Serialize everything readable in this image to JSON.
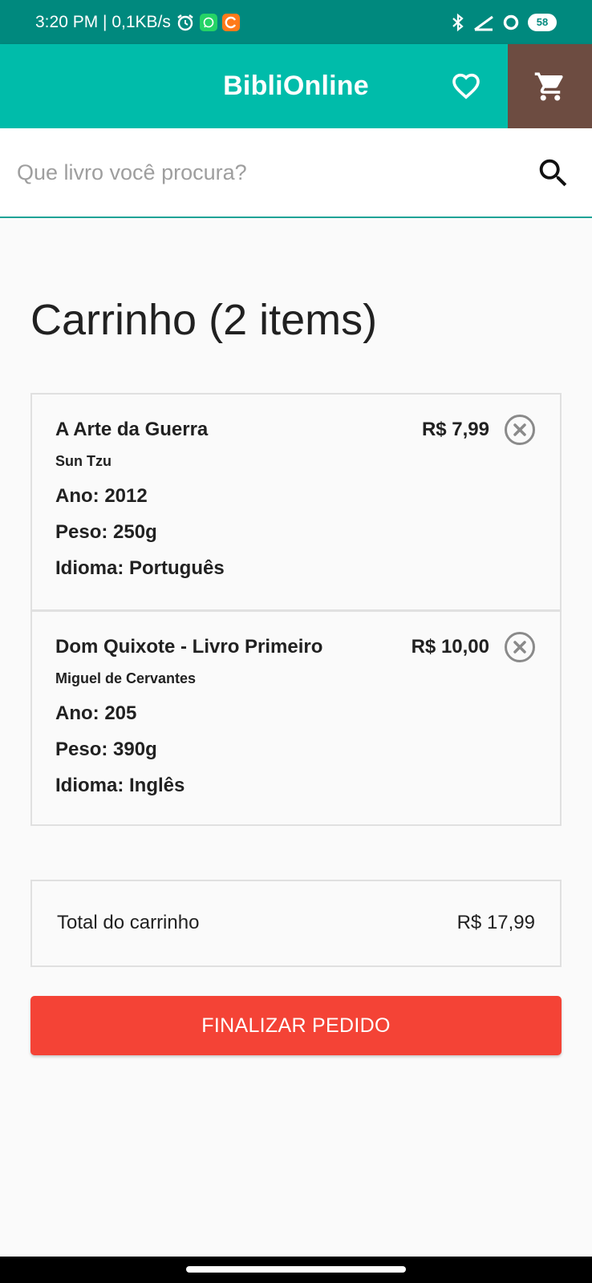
{
  "status_bar": {
    "time_speed": "3:20 PM | 0,1KB/s",
    "battery": "58",
    "icons": [
      "alarm-icon",
      "whatsapp-icon",
      "app-icon",
      "bluetooth-icon",
      "signal-icon",
      "circle-icon",
      "battery-icon"
    ],
    "colors": {
      "background": "#00897e"
    }
  },
  "app_bar": {
    "title": "BibliOnline",
    "favorites_icon": "heart-icon",
    "cart_icon": "cart-icon",
    "colors": {
      "background": "#00bcaa",
      "cart_button": "#6d4c41"
    }
  },
  "search": {
    "placeholder": "Que livro você procura?",
    "value": "",
    "icon": "search-icon"
  },
  "cart": {
    "heading": "Carrinho (2 items)",
    "items": [
      {
        "title": "A Arte da Guerra",
        "author": "Sun Tzu",
        "year": "Ano: 2012",
        "weight": "Peso: 250g",
        "language": "Idioma: Português",
        "price": "R$ 7,99"
      },
      {
        "title": "Dom Quixote - Livro Primeiro",
        "author": "Miguel de Cervantes",
        "year": "Ano: 205",
        "weight": "Peso: 390g",
        "language": "Idioma: Inglês",
        "price": "R$ 10,00"
      }
    ],
    "total_label": "Total do carrinho",
    "total_value": "R$ 17,99",
    "finalize_label": "FINALIZAR PEDIDO",
    "colors": {
      "finalize": "#f44336"
    }
  }
}
